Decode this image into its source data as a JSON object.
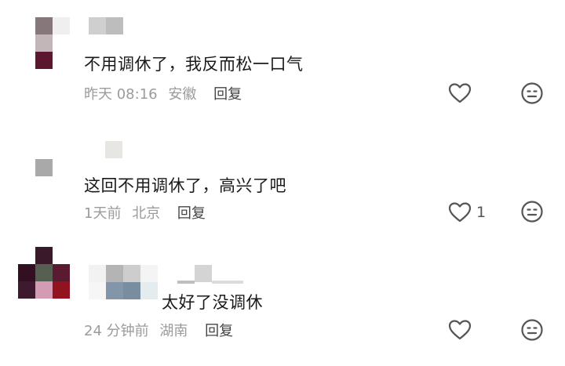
{
  "comments": [
    {
      "text": "不用调休了，我反而松一口气",
      "time": "昨天 08:16",
      "location": "安徽",
      "reply_label": "回复",
      "like_count": ""
    },
    {
      "text": "这回不用调休了，高兴了吧",
      "time": "1天前",
      "location": "北京",
      "reply_label": "回复",
      "like_count": "1"
    },
    {
      "text": "太好了没调休",
      "time": "24 分钟前",
      "location": "湖南",
      "reply_label": "回复",
      "like_count": ""
    }
  ],
  "icons": {
    "like": "heart-outline-icon",
    "dislike": "neutral-face-icon"
  },
  "colors": {
    "text": "#1a1a1a",
    "meta": "#9b9b9b",
    "icon": "#555555"
  }
}
